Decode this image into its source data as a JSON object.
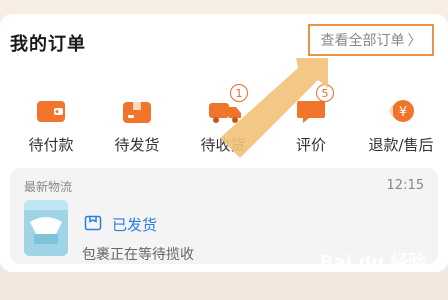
{
  "header": {
    "title": "我的订单",
    "view_all": "查看全部订单",
    "view_all_chevron": "〉"
  },
  "orders": [
    {
      "label": "待付款",
      "icon": "wallet-icon"
    },
    {
      "label": "待发货",
      "icon": "package-icon"
    },
    {
      "label": "待收货",
      "icon": "truck-icon",
      "badge": "1"
    },
    {
      "label": "评价",
      "icon": "comment-icon",
      "badge": "5"
    },
    {
      "label": "退款/售后",
      "icon": "refund-icon"
    }
  ],
  "logistics": {
    "title": "最新物流",
    "time": "12:15",
    "status": "已发货",
    "description": "包裹正在等待揽收"
  },
  "watermark": "Bai du 经验",
  "colors": {
    "accent": "#e86a2c",
    "blue": "#2a7de0",
    "highlight": "#e8924a"
  }
}
